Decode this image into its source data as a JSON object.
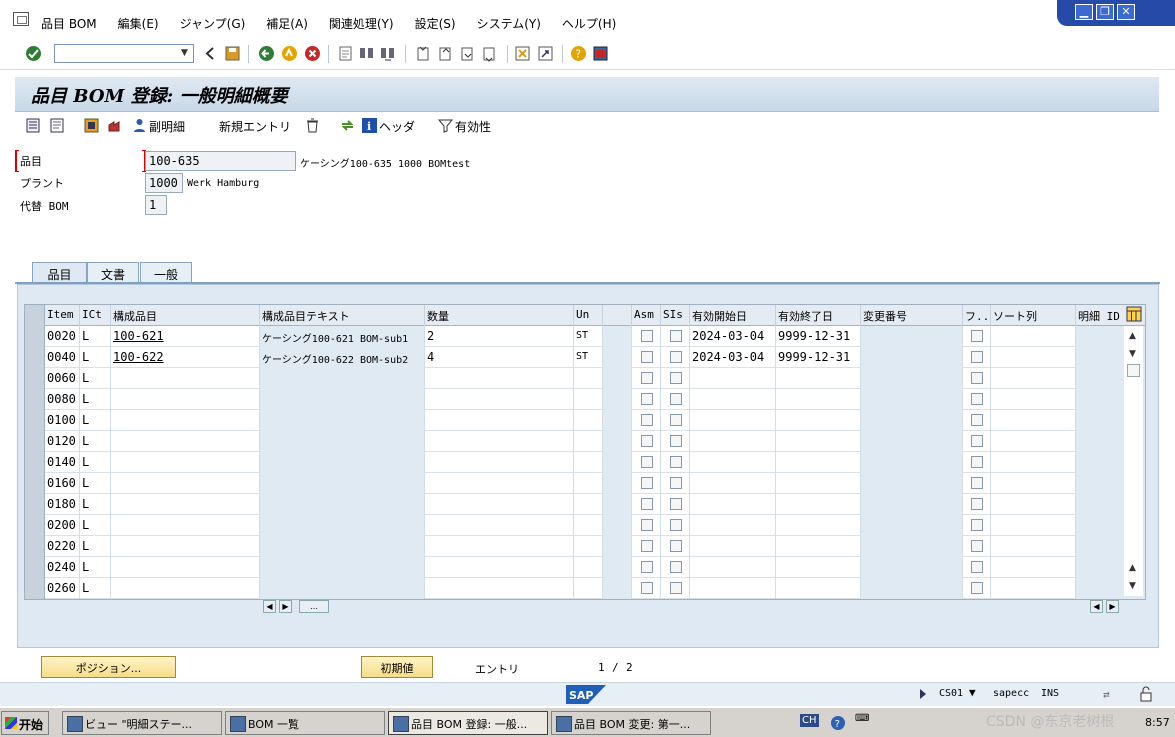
{
  "menu": [
    "品目 BOM",
    "編集(E)",
    "ジャンプ(G)",
    "補足(A)",
    "関連処理(Y)",
    "設定(S)",
    "システム(Y)",
    "ヘルプ(H)"
  ],
  "window_controls": [
    "minimize-icon",
    "restore-icon",
    "close-icon"
  ],
  "toolbar": {
    "command_field": ""
  },
  "title": "品目 BOM 登録: 一般明細概要",
  "app_toolbar": {
    "sub_item": "副明細",
    "new_entry": "新規エントリ",
    "header": "ヘッダ",
    "validity": "有効性"
  },
  "header": {
    "material_label": "品目",
    "material_value": "100-635",
    "material_desc": "ケーシング100-635 1000 BOMtest",
    "plant_label": "プラント",
    "plant_value": "1000",
    "plant_desc": "Werk Hamburg",
    "alt_label": "代替 BOM",
    "alt_value": "1"
  },
  "tabs": [
    "品目",
    "文書",
    "一般"
  ],
  "grid": {
    "columns": [
      "Item",
      "ICt",
      "構成品目",
      "構成品目テキスト",
      "数量",
      "Un",
      "",
      "Asm",
      "SIs",
      "有効開始日",
      "有効終了日",
      "変更番号",
      "フ...",
      "ソート列",
      "明細 ID"
    ],
    "rows": [
      {
        "item": "0020",
        "ict": "L",
        "comp": "100-621",
        "text": "ケーシング100-621 BOM-sub1",
        "qty": "2",
        "un": "ST",
        "from": "2024-03-04",
        "to": "9999-12-31"
      },
      {
        "item": "0040",
        "ict": "L",
        "comp": "100-622",
        "text": "ケーシング100-622 BOM-sub2",
        "qty": "4",
        "un": "ST",
        "from": "2024-03-04",
        "to": "9999-12-31"
      },
      {
        "item": "0060",
        "ict": "L",
        "comp": "",
        "text": "",
        "qty": "",
        "un": "",
        "from": "",
        "to": ""
      },
      {
        "item": "0080",
        "ict": "L",
        "comp": "",
        "text": "",
        "qty": "",
        "un": "",
        "from": "",
        "to": ""
      },
      {
        "item": "0100",
        "ict": "L",
        "comp": "",
        "text": "",
        "qty": "",
        "un": "",
        "from": "",
        "to": ""
      },
      {
        "item": "0120",
        "ict": "L",
        "comp": "",
        "text": "",
        "qty": "",
        "un": "",
        "from": "",
        "to": ""
      },
      {
        "item": "0140",
        "ict": "L",
        "comp": "",
        "text": "",
        "qty": "",
        "un": "",
        "from": "",
        "to": ""
      },
      {
        "item": "0160",
        "ict": "L",
        "comp": "",
        "text": "",
        "qty": "",
        "un": "",
        "from": "",
        "to": ""
      },
      {
        "item": "0180",
        "ict": "L",
        "comp": "",
        "text": "",
        "qty": "",
        "un": "",
        "from": "",
        "to": ""
      },
      {
        "item": "0200",
        "ict": "L",
        "comp": "",
        "text": "",
        "qty": "",
        "un": "",
        "from": "",
        "to": ""
      },
      {
        "item": "0220",
        "ict": "L",
        "comp": "",
        "text": "",
        "qty": "",
        "un": "",
        "from": "",
        "to": ""
      },
      {
        "item": "0240",
        "ict": "L",
        "comp": "",
        "text": "",
        "qty": "",
        "un": "",
        "from": "",
        "to": ""
      },
      {
        "item": "0260",
        "ict": "L",
        "comp": "",
        "text": "",
        "qty": "",
        "un": "",
        "from": "",
        "to": ""
      }
    ]
  },
  "bottom": {
    "position_btn": "ポジション...",
    "initial_btn": "初期値",
    "entry_label": "エントリ",
    "entry_pos": "1",
    "entry_total": "2",
    "sep": "/"
  },
  "status": {
    "tcode": "CS01",
    "server": "sapecc",
    "mode": "INS"
  },
  "taskbar": {
    "start": "开始",
    "tasks": [
      "ビュー \"明細ステー...",
      "BOM 一覧",
      "品目 BOM 登録: 一般...",
      "品目 BOM 変更: 第一..."
    ],
    "lang": "CH",
    "time": "8:57",
    "watermark": "CSDN @东京老树根"
  }
}
